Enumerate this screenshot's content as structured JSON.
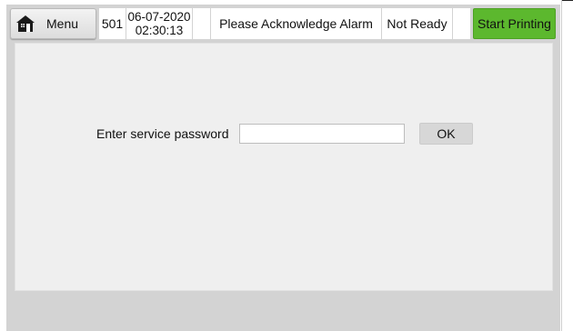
{
  "header": {
    "menu_label": "Menu",
    "station_number": "501",
    "date": "06-07-2020",
    "time": "02:30:13",
    "alarm_text": "Please Acknowledge Alarm",
    "status_text": "Not Ready",
    "start_label": "Start Printing",
    "start_color": "#5cb82e",
    "menu_icon": "home-icon"
  },
  "service": {
    "prompt": "Enter service password",
    "password_value": "",
    "ok_label": "OK"
  }
}
